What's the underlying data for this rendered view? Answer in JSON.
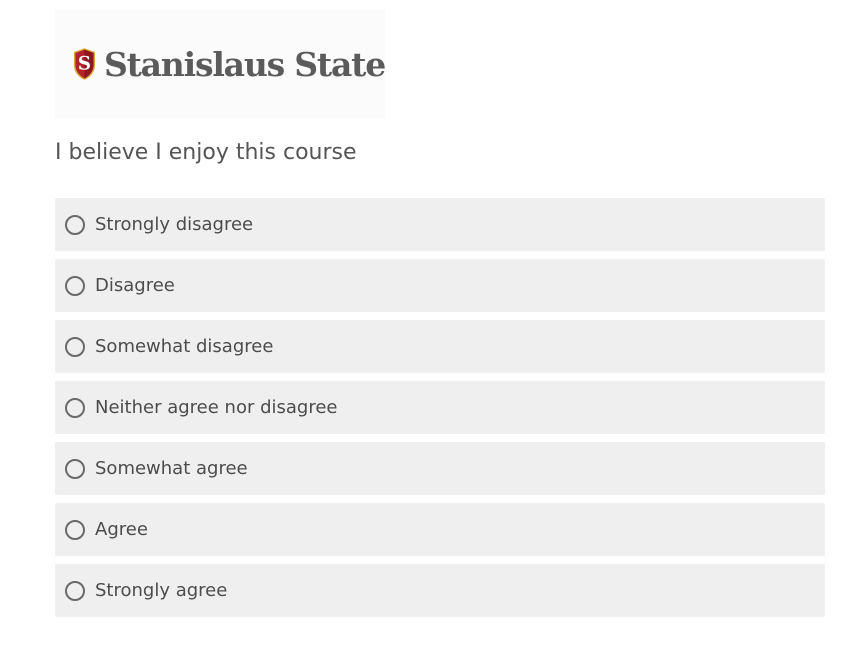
{
  "logo": {
    "text": "Stanislaus State",
    "shield_letter": "S",
    "shield_color": "#b5222b",
    "shield_border": "#d9a83a"
  },
  "question": {
    "text": "I believe I enjoy this course"
  },
  "options": [
    {
      "label": "Strongly disagree",
      "selected": false
    },
    {
      "label": "Disagree",
      "selected": false
    },
    {
      "label": "Somewhat disagree",
      "selected": false
    },
    {
      "label": "Neither agree nor disagree",
      "selected": false
    },
    {
      "label": "Somewhat agree",
      "selected": false
    },
    {
      "label": "Agree",
      "selected": false
    },
    {
      "label": "Strongly agree",
      "selected": false
    }
  ],
  "colors": {
    "option_background": "#efefef",
    "text": "#555555"
  }
}
